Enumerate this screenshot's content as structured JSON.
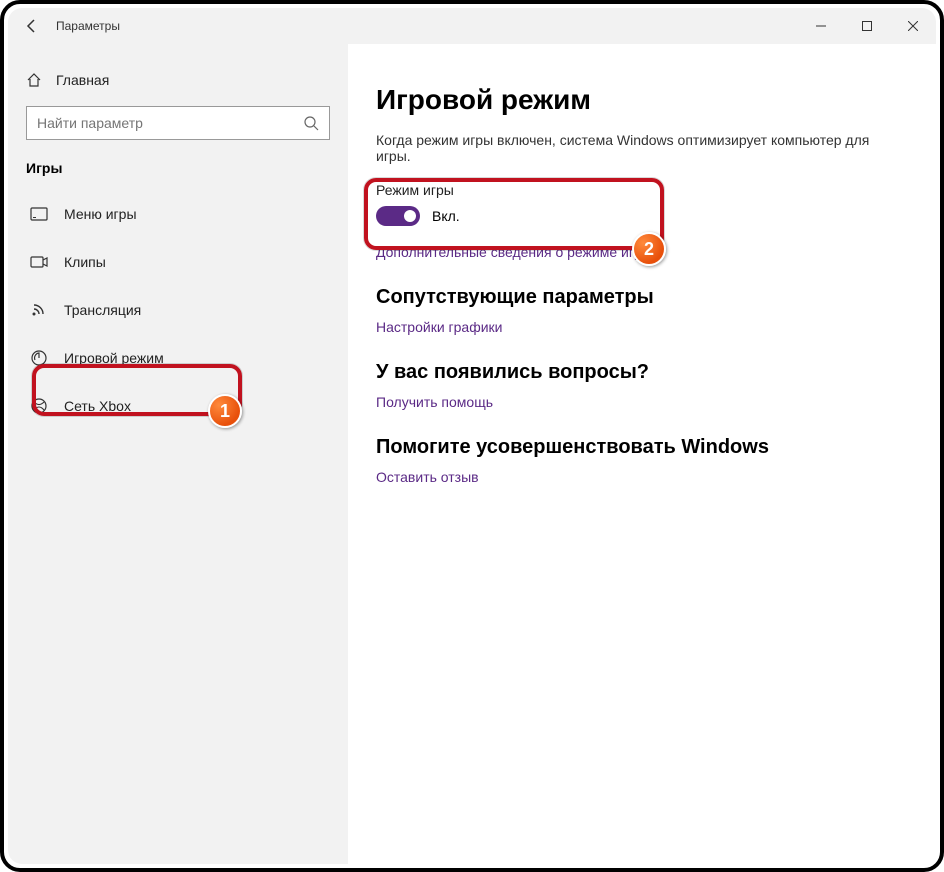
{
  "titlebar": {
    "title": "Параметры"
  },
  "sidebar": {
    "home_label": "Главная",
    "search_placeholder": "Найти параметр",
    "category": "Игры",
    "items": [
      {
        "label": "Меню игры"
      },
      {
        "label": "Клипы"
      },
      {
        "label": "Трансляция"
      },
      {
        "label": "Игровой режим"
      },
      {
        "label": "Сеть Xbox"
      }
    ]
  },
  "main": {
    "title": "Игровой режим",
    "description": "Когда режим игры включен, система Windows оптимизирует компьютер для игры.",
    "setting_label": "Режим игры",
    "toggle_state": "Вкл.",
    "more_info_link": "Дополнительные сведения о режиме игры",
    "related_heading": "Сопутствующие параметры",
    "related_link": "Настройки графики",
    "help_heading": "У вас появились вопросы?",
    "help_link": "Получить помощь",
    "feedback_heading": "Помогите усовершенствовать Windows",
    "feedback_link": "Оставить отзыв"
  },
  "badges": {
    "b1": "1",
    "b2": "2"
  }
}
